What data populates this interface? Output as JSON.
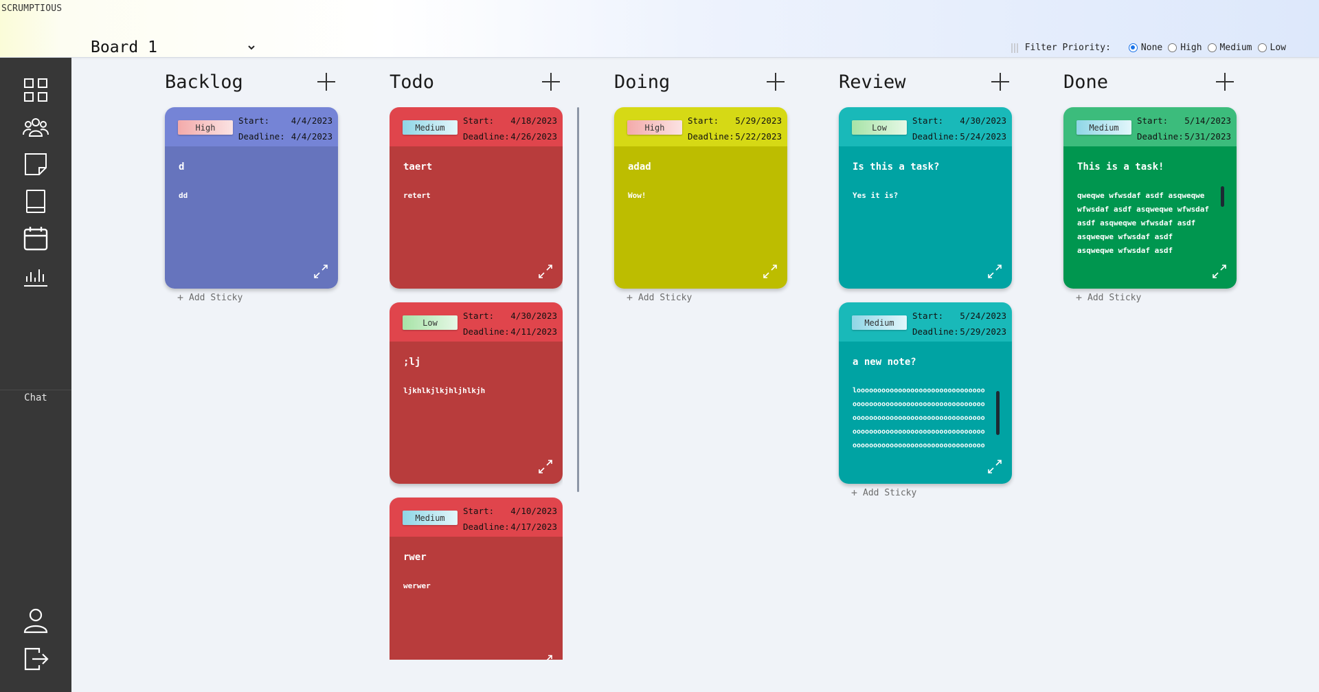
{
  "app": {
    "title": "SCRUMPTIOUS"
  },
  "board": {
    "selected": "Board 1"
  },
  "filter": {
    "label": "Filter Priority:",
    "options": [
      "None",
      "High",
      "Medium",
      "Low"
    ],
    "selected": "None"
  },
  "sidebar": {
    "icons": [
      "dashboard-icon",
      "team-icon",
      "sticky-note-icon",
      "book-icon",
      "calendar-icon",
      "chart-icon",
      "user-icon",
      "logout-icon"
    ],
    "chat_label": "Chat"
  },
  "labels": {
    "start": "Start:",
    "deadline": "Deadline:",
    "add_sticky": "Add Sticky"
  },
  "colors": {
    "purple_head": "#7584d6",
    "purple_body": "#6674bd",
    "red_head": "#e0454c",
    "red_body": "#b83c3c",
    "yellow_head": "#d6d915",
    "yellow_body": "#bdbd00",
    "teal_head": "#19b9b9",
    "teal_body": "#00a3a3",
    "green_head": "#3cbc7c",
    "green_body": "#00964f",
    "sidebar": "#373737"
  },
  "columns": [
    {
      "title": "Backlog",
      "cards": [
        {
          "priority": "High",
          "start": "4/4/2023",
          "deadline": "4/4/2023",
          "title": "d",
          "text": "dd"
        }
      ]
    },
    {
      "title": "Todo",
      "cards": [
        {
          "priority": "Medium",
          "start": "4/18/2023",
          "deadline": "4/26/2023",
          "title": "taert",
          "text": "retert"
        },
        {
          "priority": "Low",
          "start": "4/30/2023",
          "deadline": "4/11/2023",
          "title": ";lj",
          "text": "ljkhlkjlkjhljhlkjh"
        },
        {
          "priority": "Medium",
          "start": "4/10/2023",
          "deadline": "4/17/2023",
          "title": "rwer",
          "text": "werwer"
        }
      ]
    },
    {
      "title": "Doing",
      "cards": [
        {
          "priority": "High",
          "start": "5/29/2023",
          "deadline": "5/22/2023",
          "title": "adad",
          "text": "Wow!"
        }
      ]
    },
    {
      "title": "Review",
      "cards": [
        {
          "priority": "Low",
          "start": "4/30/2023",
          "deadline": "5/24/2023",
          "title": "Is this a task?",
          "text": "Yes it is?"
        },
        {
          "priority": "Medium",
          "start": "5/24/2023",
          "deadline": "5/29/2023",
          "title": "a new note?",
          "text": "looooooooooooooooooooooooooooooooooooooooooooooooooooooooooooooooooooooooooooooooooooooooooooooooooooooooooooooooooooooooooooooooooooooooooooooooooooooooooooooooooooooooooooooooooooooo"
        }
      ]
    },
    {
      "title": "Done",
      "cards": [
        {
          "priority": "Medium",
          "start": "5/14/2023",
          "deadline": "5/31/2023",
          "title": "This is a task!",
          "text": "qweqwe wfwsdaf asdf asqweqwe wfwsdaf asdf asqweqwe wfwsdaf asdf asqweqwe wfwsdaf asdf asqweqwe wfwsdaf asdf asqweqwe wfwsdaf asdf asqweqwe wfwsdaf"
        }
      ]
    }
  ]
}
